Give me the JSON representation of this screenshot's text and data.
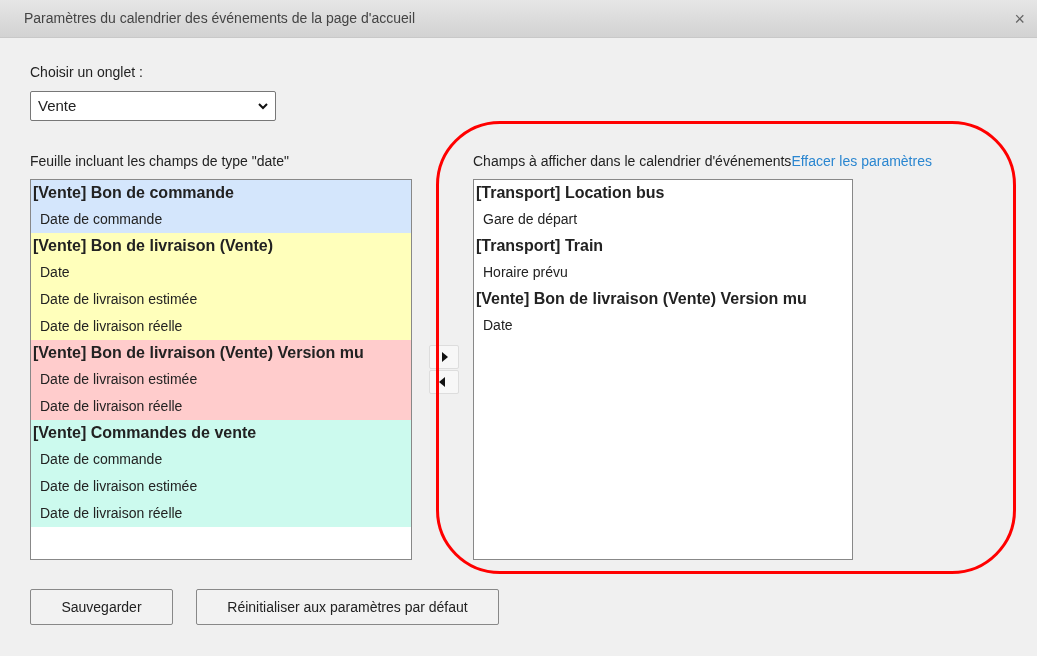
{
  "window": {
    "title": "Paramètres du calendrier des événements de la page d'accueil",
    "close": "×"
  },
  "tab_select": {
    "label": "Choisir un onglet :",
    "value": "Vente"
  },
  "source_list": {
    "label": "Feuille incluant les champs de type \"date\"",
    "groups": [
      {
        "title": "[Vente] Bon de commande",
        "color": "#d4e6fc",
        "fields": [
          "Date de commande"
        ]
      },
      {
        "title": "[Vente] Bon de livraison (Vente)",
        "color": "#ffffbb",
        "fields": [
          "Date",
          "Date de livraison estimée",
          "Date de livraison réelle"
        ]
      },
      {
        "title": "[Vente] Bon de livraison (Vente) Version mu",
        "color": "#ffcccc",
        "fields": [
          "Date de livraison estimée",
          "Date de livraison réelle"
        ]
      },
      {
        "title": "[Vente] Commandes de vente",
        "color": "#ccfaee",
        "fields": [
          "Date de commande",
          "Date de livraison estimée",
          "Date de livraison réelle"
        ]
      }
    ]
  },
  "target_list": {
    "label": "Champs à afficher dans le calendrier d'événements",
    "clear_link": "Effacer les paramètres",
    "groups": [
      {
        "title": "[Transport] Location bus",
        "fields": [
          "Gare de départ"
        ]
      },
      {
        "title": "[Transport] Train",
        "fields": [
          "Horaire prévu"
        ]
      },
      {
        "title": "[Vente] Bon de livraison (Vente) Version mu",
        "fields": [
          "Date"
        ]
      }
    ]
  },
  "buttons": [
    "Sauvegarder",
    "Réinitialiser aux paramètres par défaut"
  ]
}
